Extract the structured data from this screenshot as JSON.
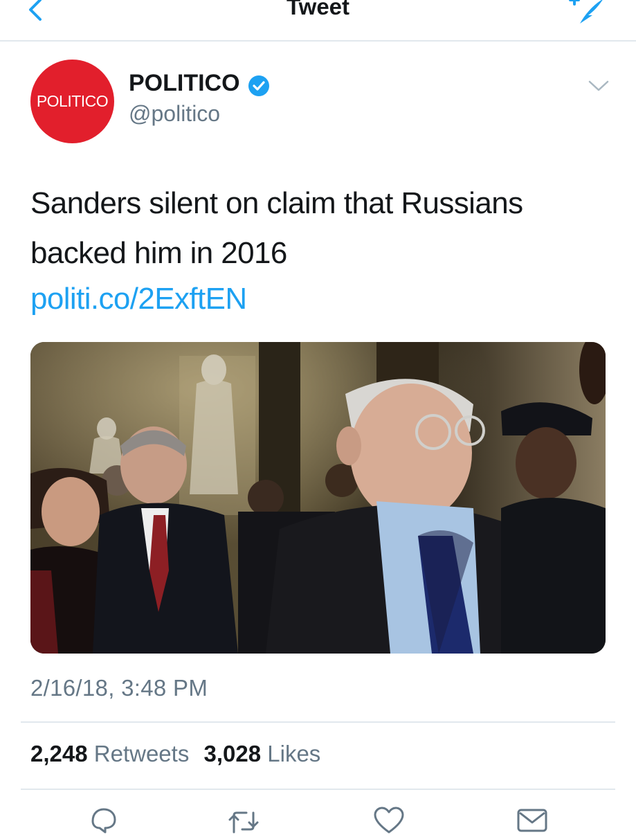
{
  "nav": {
    "title": "Tweet",
    "back_icon": "chevron-left-icon",
    "compose_icon": "compose-tweet-icon"
  },
  "author": {
    "avatar_text": "POLITICO",
    "display_name": "POLITICO",
    "handle": "@politico",
    "verified_icon": "verified-badge-icon"
  },
  "tweet": {
    "text": "Sanders silent on claim that Russians backed him in 2016",
    "link": "politi.co/2ExftEN",
    "timestamp": "2/16/18, 3:48 PM"
  },
  "stats": {
    "retweets_count": "2,248",
    "retweets_label": "Retweets",
    "likes_count": "3,028",
    "likes_label": "Likes"
  },
  "actions": [
    "reply-icon",
    "retweet-icon",
    "like-icon",
    "share-icon"
  ],
  "colors": {
    "accent": "#1da1f2",
    "brand_red": "#e21f2c",
    "secondary_text": "#657786",
    "divider": "#e1e8ed"
  }
}
